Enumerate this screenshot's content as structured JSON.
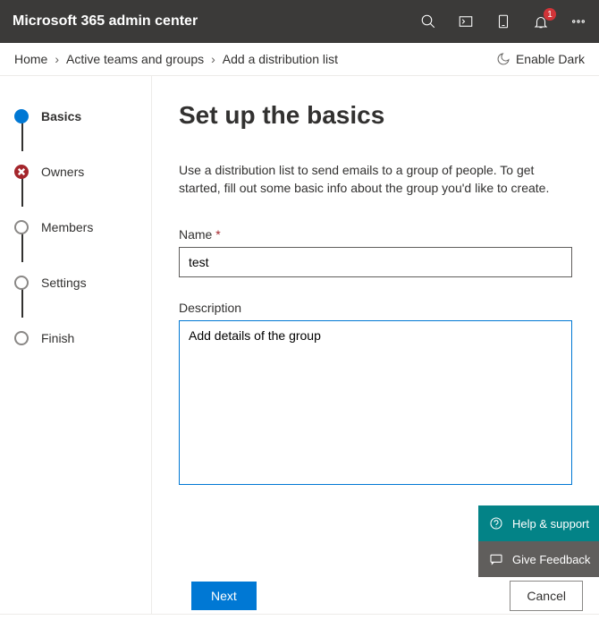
{
  "header": {
    "title": "Microsoft 365 admin center",
    "notification_count": "1"
  },
  "breadcrumb": {
    "items": [
      "Home",
      "Active teams and groups",
      "Add a distribution list"
    ],
    "dark_toggle": "Enable Dark"
  },
  "steps": [
    {
      "label": "Basics",
      "state": "active"
    },
    {
      "label": "Owners",
      "state": "error"
    },
    {
      "label": "Members",
      "state": "pending"
    },
    {
      "label": "Settings",
      "state": "pending"
    },
    {
      "label": "Finish",
      "state": "pending"
    }
  ],
  "page": {
    "heading": "Set up the basics",
    "description": "Use a distribution list to send emails to a group of people. To get started, fill out some basic info about the group you'd like to create.",
    "name_label": "Name",
    "name_value": "test",
    "desc_label": "Description",
    "desc_value": "Add details of the group"
  },
  "footer": {
    "next": "Next",
    "cancel": "Cancel"
  },
  "help": {
    "support": "Help & support",
    "feedback": "Give Feedback"
  }
}
